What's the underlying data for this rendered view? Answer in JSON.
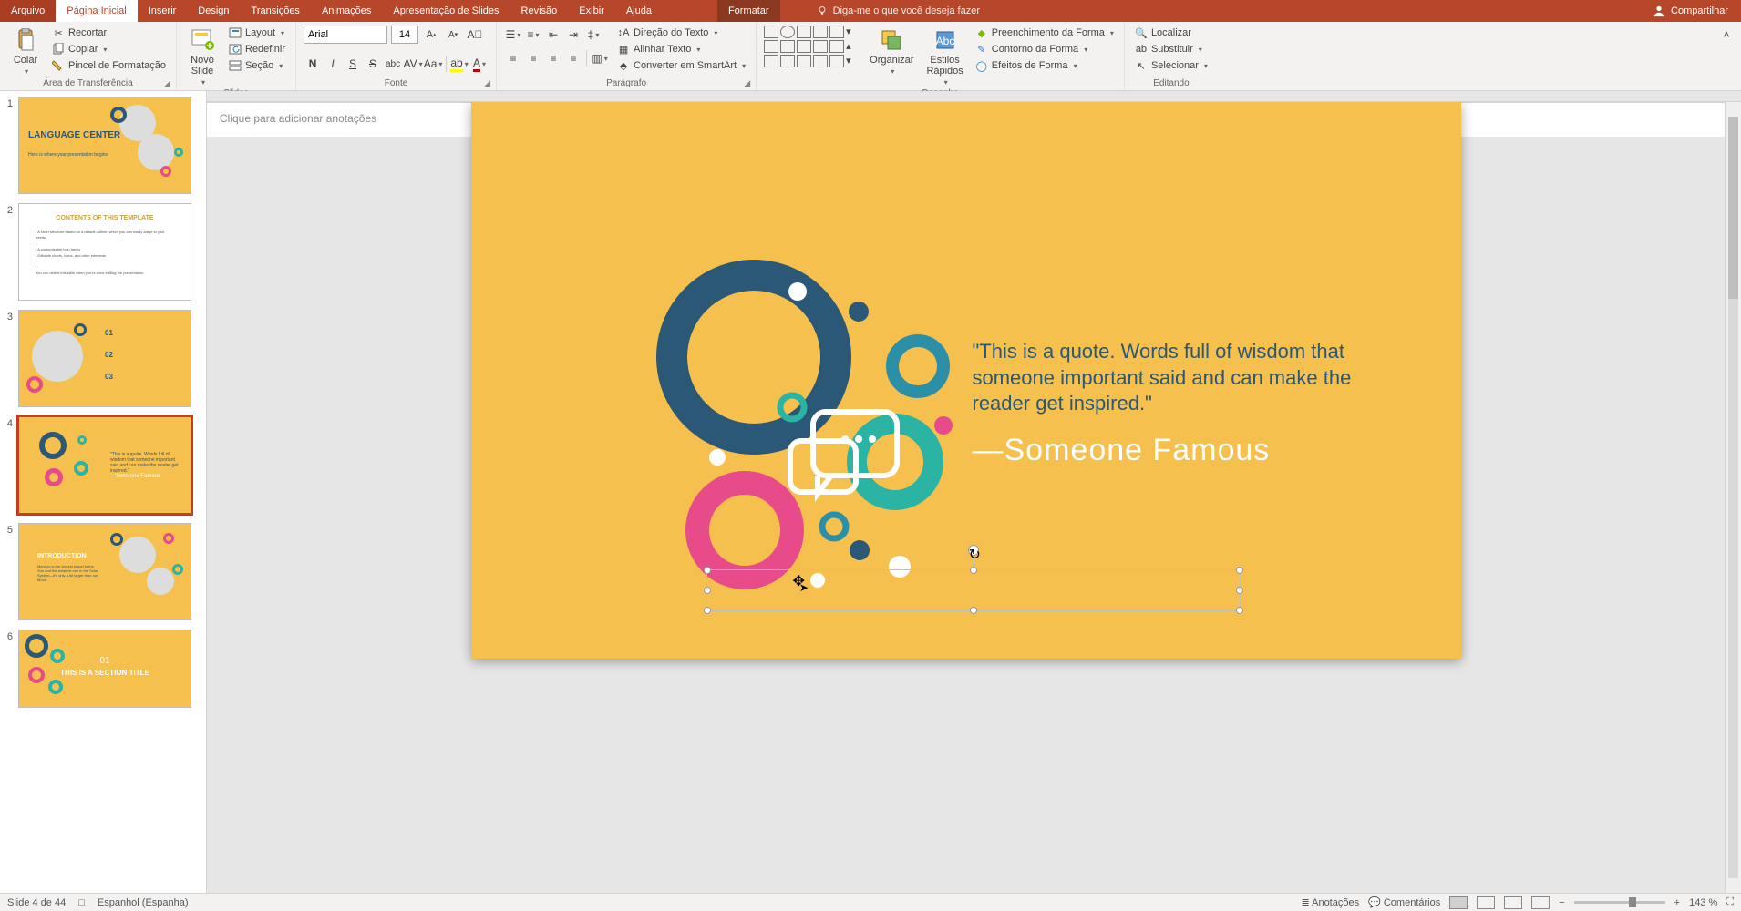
{
  "tabs": {
    "file": "Arquivo",
    "home": "Página Inicial",
    "insert": "Inserir",
    "design": "Design",
    "transitions": "Transições",
    "animations": "Animações",
    "slideshow": "Apresentação de Slides",
    "review": "Revisão",
    "view": "Exibir",
    "help": "Ajuda",
    "format": "Formatar",
    "tell_me": "Diga-me o que você deseja fazer",
    "share": "Compartilhar"
  },
  "ribbon": {
    "clipboard": {
      "title": "Área de Transferência",
      "paste": "Colar",
      "cut": "Recortar",
      "copy": "Copiar",
      "format_painter": "Pincel de Formatação"
    },
    "slides": {
      "title": "Slides",
      "new_slide": "Novo\nSlide",
      "layout": "Layout",
      "reset": "Redefinir",
      "section": "Seção"
    },
    "font": {
      "title": "Fonte",
      "name": "Arial",
      "size": "14"
    },
    "paragraph": {
      "title": "Parágrafo",
      "text_direction": "Direção do Texto",
      "align_text": "Alinhar Texto",
      "convert_smartart": "Converter em SmartArt"
    },
    "drawing": {
      "title": "Desenho",
      "arrange": "Organizar",
      "quick_styles": "Estilos\nRápidos",
      "shape_fill": "Preenchimento da Forma",
      "shape_outline": "Contorno da Forma",
      "shape_effects": "Efeitos de Forma"
    },
    "editing": {
      "title": "Editando",
      "find": "Localizar",
      "replace": "Substituir",
      "select": "Selecionar"
    }
  },
  "slide": {
    "quote": "\"This is a quote. Words full of wisdom that someone important said and can make the reader get inspired.\"",
    "author": "—Someone Famous"
  },
  "thumbnails": {
    "t1_title": "LANGUAGE CENTER",
    "t1_sub": "Here is where your presentation begins",
    "t2_title": "CONTENTS OF THIS TEMPLATE",
    "t5_title": "INTRODUCTION",
    "t6_num": "01",
    "t6_title": "THIS IS A SECTION TITLE"
  },
  "notes_placeholder": "Clique para adicionar anotações",
  "status": {
    "slide": "Slide 4 de 44",
    "lang": "Espanhol (Espanha)",
    "notes": "Anotações",
    "comments": "Comentários",
    "zoom": "143 %"
  }
}
